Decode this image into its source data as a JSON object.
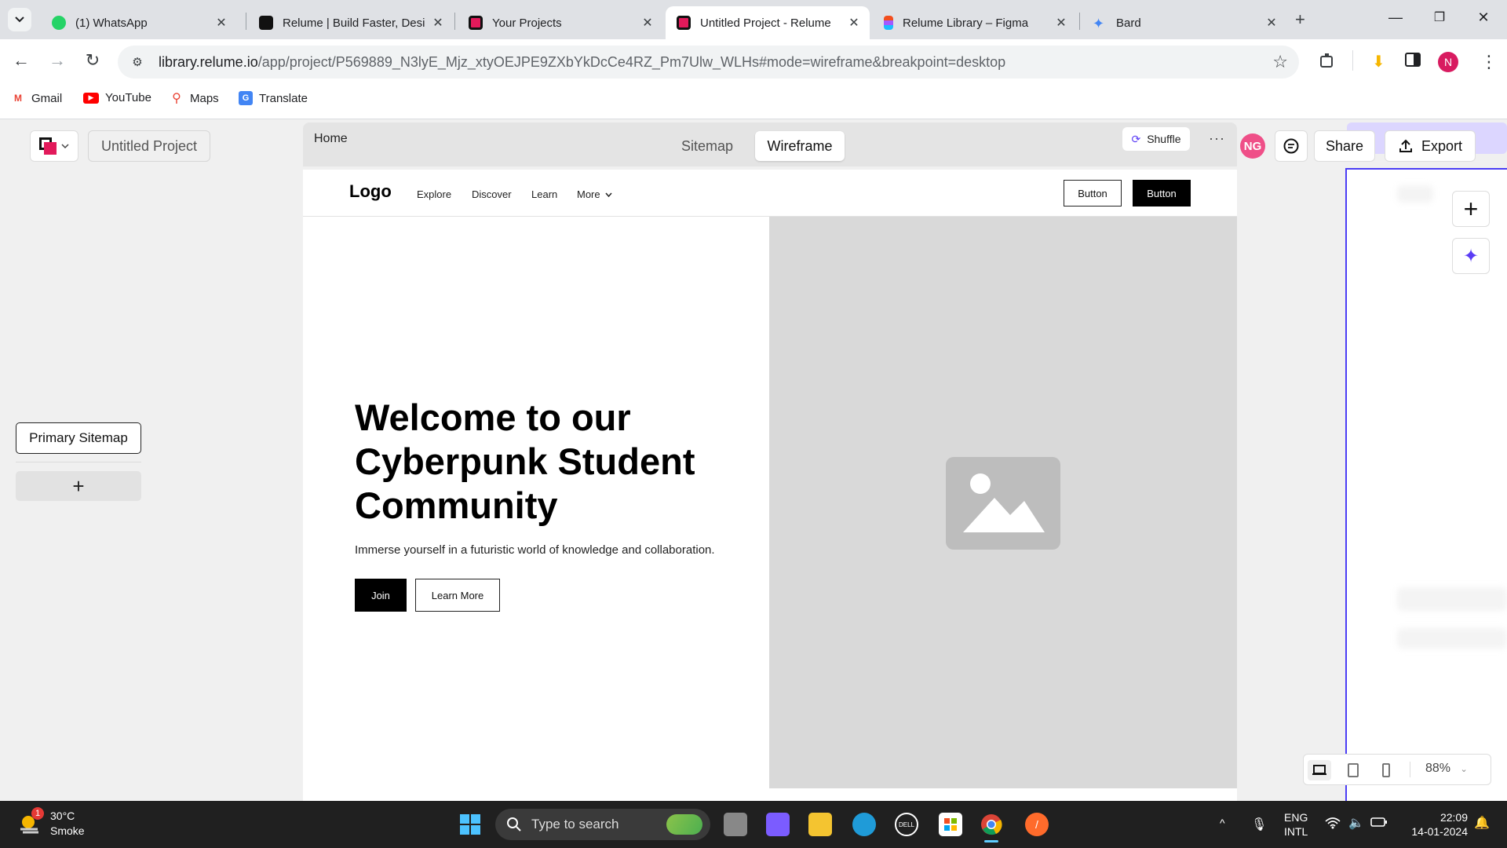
{
  "browser": {
    "tabs": [
      {
        "title": "(1) WhatsApp",
        "icon": "whatsapp-icon",
        "color": "#25d366"
      },
      {
        "title": "Relume | Build Faster, Desi",
        "icon": "relume-icon",
        "color": "#e21a5b"
      },
      {
        "title": "Your Projects",
        "icon": "relume-icon",
        "color": "#e21a5b"
      },
      {
        "title": "Untitled Project - Relume",
        "icon": "relume-icon",
        "color": "#e21a5b"
      },
      {
        "title": "Relume Library – Figma",
        "icon": "figma-icon",
        "color": "#f24e1e"
      },
      {
        "title": "Bard",
        "icon": "bard-icon",
        "color": "#4285f4"
      }
    ],
    "active_tab_index": 3,
    "url_host": "library.relume.io",
    "url_rest": "/app/project/P569889_N3lyE_Mjz_xtyOEJPE9ZXbYkDcCe4RZ_Pm7Ulw_WLHs#mode=wireframe&breakpoint=desktop",
    "profile_initial": "N",
    "bookmarks": [
      {
        "label": "Gmail",
        "icon": "gmail-icon"
      },
      {
        "label": "YouTube",
        "icon": "youtube-icon"
      },
      {
        "label": "Maps",
        "icon": "maps-icon"
      },
      {
        "label": "Translate",
        "icon": "translate-icon"
      }
    ]
  },
  "app": {
    "project_name": "Untitled Project",
    "sidebar": {
      "sitemap_label": "Primary Sitemap",
      "add_label": "+"
    },
    "page_label": "Home",
    "modes": [
      "Sitemap",
      "Wireframe"
    ],
    "active_mode": "Wireframe",
    "shuffle_label": "Shuffle",
    "more_label": "···",
    "user_initials": "NG",
    "share_label": "Share",
    "export_label": "Export",
    "zoom": "88%",
    "accent": "#4b3df5"
  },
  "wireframe": {
    "logo": "Logo",
    "nav_links": [
      "Explore",
      "Discover",
      "Learn",
      "More"
    ],
    "nav_button_outline": "Button",
    "nav_button_solid": "Button",
    "hero_title": "Welcome to our Cyberpunk Student Community",
    "hero_subtitle": "Immerse yourself in a futuristic world of knowledge and collaboration.",
    "cta_primary": "Join",
    "cta_secondary": "Learn More"
  },
  "taskbar": {
    "temperature": "30°C",
    "weather": "Smoke",
    "weather_badge": "1",
    "search_placeholder": "Type to search",
    "lang_line1": "ENG",
    "lang_line2": "INTL",
    "time": "22:09",
    "date": "14-01-2024"
  }
}
